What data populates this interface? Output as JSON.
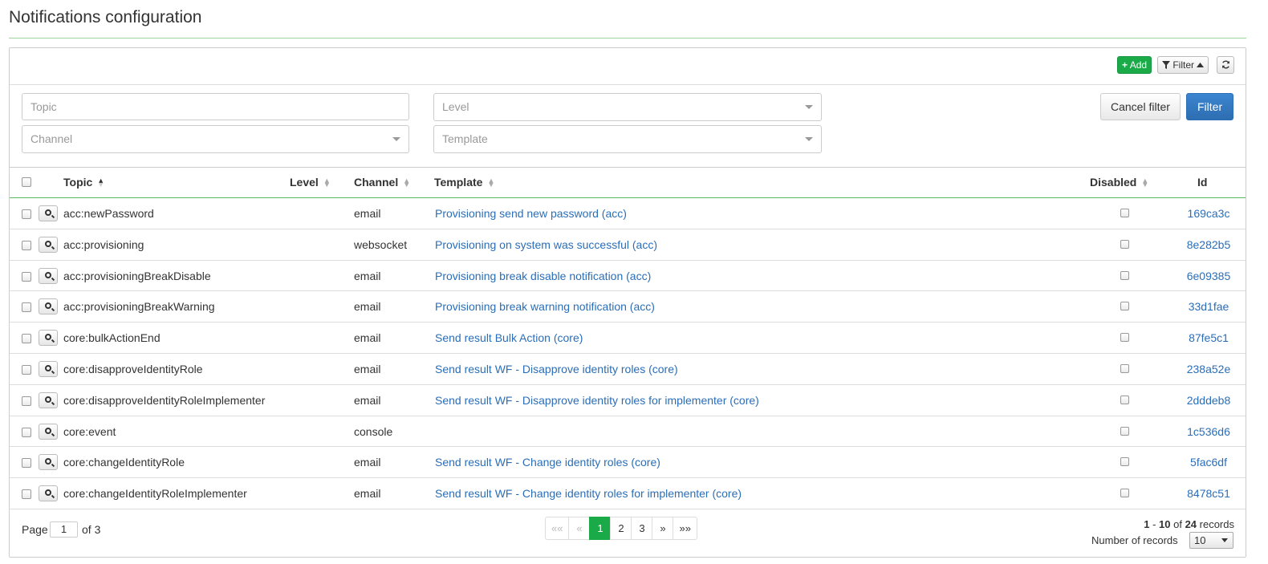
{
  "page": {
    "title": "Notifications configuration"
  },
  "toolbar": {
    "add_label": "Add",
    "filter_label": "Filter",
    "refresh_icon": "refresh-icon"
  },
  "filter": {
    "topic_placeholder": "Topic",
    "level_placeholder": "Level",
    "channel_placeholder": "Channel",
    "template_placeholder": "Template",
    "cancel_label": "Cancel filter",
    "apply_label": "Filter"
  },
  "table": {
    "columns": {
      "topic": "Topic",
      "level": "Level",
      "channel": "Channel",
      "template": "Template",
      "disabled": "Disabled",
      "id": "Id"
    },
    "rows": [
      {
        "topic": "acc:newPassword",
        "level": "",
        "channel": "email",
        "template": "Provisioning send new password (acc)",
        "id": "169ca3c"
      },
      {
        "topic": "acc:provisioning",
        "level": "",
        "channel": "websocket",
        "template": "Provisioning on system was successful (acc)",
        "id": "8e282b5"
      },
      {
        "topic": "acc:provisioningBreakDisable",
        "level": "",
        "channel": "email",
        "template": "Provisioning break disable notification (acc)",
        "id": "6e09385"
      },
      {
        "topic": "acc:provisioningBreakWarning",
        "level": "",
        "channel": "email",
        "template": "Provisioning break warning notification (acc)",
        "id": "33d1fae"
      },
      {
        "topic": "core:bulkActionEnd",
        "level": "",
        "channel": "email",
        "template": "Send result Bulk Action (core)",
        "id": "87fe5c1"
      },
      {
        "topic": "core:disapproveIdentityRole",
        "level": "",
        "channel": "email",
        "template": "Send result WF - Disapprove identity roles (core)",
        "id": "238a52e"
      },
      {
        "topic": "core:disapproveIdentityRoleImplementer",
        "level": "",
        "channel": "email",
        "template": "Send result WF - Disapprove identity roles for implementer (core)",
        "id": "2dddeb8"
      },
      {
        "topic": "core:event",
        "level": "",
        "channel": "console",
        "template": "",
        "id": "1c536d6"
      },
      {
        "topic": "core:changeIdentityRole",
        "level": "",
        "channel": "email",
        "template": "Send result WF - Change identity roles (core)",
        "id": "5fac6df"
      },
      {
        "topic": "core:changeIdentityRoleImplementer",
        "level": "",
        "channel": "email",
        "template": "Send result WF - Change identity roles for implementer (core)",
        "id": "8478c51"
      }
    ]
  },
  "footer": {
    "page_label": "Page",
    "current_page": "1",
    "of_label": "of 3",
    "pager": [
      "««",
      "«",
      "1",
      "2",
      "3",
      "»",
      "»»"
    ],
    "range_from": "1",
    "range_sep": " - ",
    "range_to": "10",
    "of_word": " of ",
    "total": "24",
    "records_word": " records",
    "records_label": "Number of records",
    "records_value": "10"
  },
  "colors": {
    "accent_green": "#1aaa48",
    "primary_blue": "#2e6db1",
    "link": "#2a6eb8"
  }
}
